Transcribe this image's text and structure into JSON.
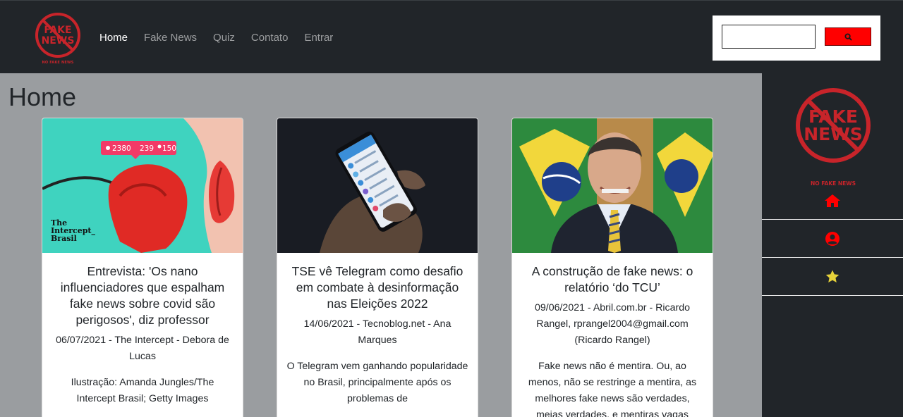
{
  "navbar": {
    "brand_caption": "NO FAKE NEWS",
    "links": [
      "Home",
      "Fake News",
      "Quiz",
      "Contato",
      "Entrar"
    ],
    "active_index": 0,
    "search": {
      "value": "",
      "button_icon": "search-icon"
    }
  },
  "main": {
    "title": "Home",
    "cards": [
      {
        "title": "Entrevista: 'Os nano influenciadores que espalham fake news sobre covid são perigosos', diz professor",
        "meta": "06/07/2021 - The Intercept - Debora de Lucas",
        "text": "Ilustração: Amanda Jungles/The Intercept Brasil; Getty Images",
        "image": {
          "badge_views": "2380",
          "badge_likes": "239",
          "badge_followers": "150",
          "logo_line1": "The",
          "logo_line2": "Intercept_",
          "logo_line3": "Brasil"
        }
      },
      {
        "title": "TSE vê Telegram como desafio em combate à desinformação nas Eleições 2022",
        "meta": "14/06/2021 - Tecnoblog.net - Ana Marques",
        "text": "O Telegram vem ganhando popularidade no Brasil, principalmente após os problemas de"
      },
      {
        "title": "A construção de fake news: o relatório ‘do TCU’",
        "meta": "09/06/2021 - Abril.com.br - Ricardo Rangel, rprangel2004@gmail.com (Ricardo Rangel)",
        "text": "Fake news não é mentira. Ou, ao menos, não se restringe a mentira, as melhores fake news são verdades, meias verdades, e mentiras vagas"
      }
    ]
  },
  "sidebar": {
    "caption": "NO FAKE NEWS",
    "items": [
      {
        "icon": "home-icon",
        "color": "#ff0000"
      },
      {
        "icon": "user-circle-icon",
        "color": "#ff0000"
      },
      {
        "icon": "star-icon",
        "color": "#e6d23a"
      }
    ]
  },
  "colors": {
    "brand_red": "#c8242a",
    "accent_red": "#ff0000",
    "navbar": "#212529",
    "main_bg": "#9a9da0"
  }
}
